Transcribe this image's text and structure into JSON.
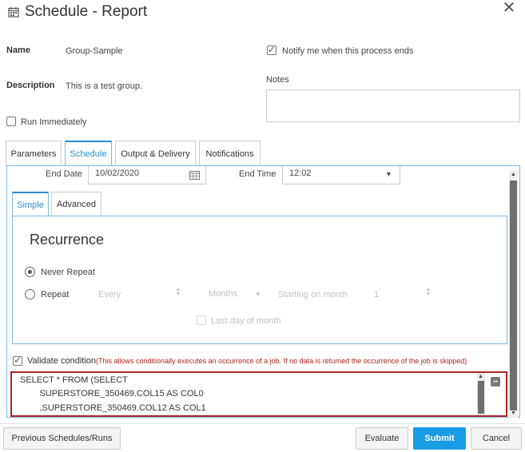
{
  "header": {
    "title": "Schedule - Report",
    "calendar_icon": "calendar-icon",
    "close_icon": "close-icon"
  },
  "form": {
    "name_label": "Name",
    "name_value": "Group-Sample",
    "description_label": "Description",
    "description_value": "This is a test group.",
    "run_immediately_label": "Run Immediately",
    "run_immediately_checked": false,
    "notify_label": "Notify me when this process ends",
    "notify_checked": true,
    "notes_label": "Notes",
    "notes_value": ""
  },
  "tabs": [
    {
      "label": "Parameters",
      "active": false
    },
    {
      "label": "Schedule",
      "active": true
    },
    {
      "label": "Output & Delivery",
      "active": false
    },
    {
      "label": "Notifications",
      "active": false
    }
  ],
  "schedule": {
    "end_date_label": "End Date",
    "end_date_value": "10/02/2020",
    "end_time_label": "End Time",
    "end_time_value": "12:02",
    "subtabs": [
      {
        "label": "Simple",
        "active": true
      },
      {
        "label": "Advanced",
        "active": false
      }
    ],
    "recurrence_title": "Recurrence",
    "never_repeat_label": "Never Repeat",
    "never_repeat_selected": true,
    "repeat_label": "Repeat",
    "every_placeholder": "Every",
    "period_value": "Months",
    "starting_on_label": "Starting on month",
    "starting_month_value": "1",
    "last_day_label": "Last day of month",
    "validate_label": "Validate condition",
    "validate_checked": true,
    "validate_note": "(This allows conditionally executes an occurrence of a job. If no data is returned the occurrence of the job is skipped)",
    "sql_lines": [
      "SELECT * FROM (SELECT",
      "        SUPERSTORE_350469.COL15 AS COL0",
      "        ,SUPERSTORE_350469.COL12 AS COL1"
    ]
  },
  "footer": {
    "previous_label": "Previous Schedules/Runs",
    "evaluate_label": "Evaluate",
    "submit_label": "Submit",
    "cancel_label": "Cancel"
  },
  "colors": {
    "accent": "#2a8bd1",
    "submit": "#1a9be6",
    "validate_note": "#b22222",
    "sql_border": "#b22222"
  }
}
